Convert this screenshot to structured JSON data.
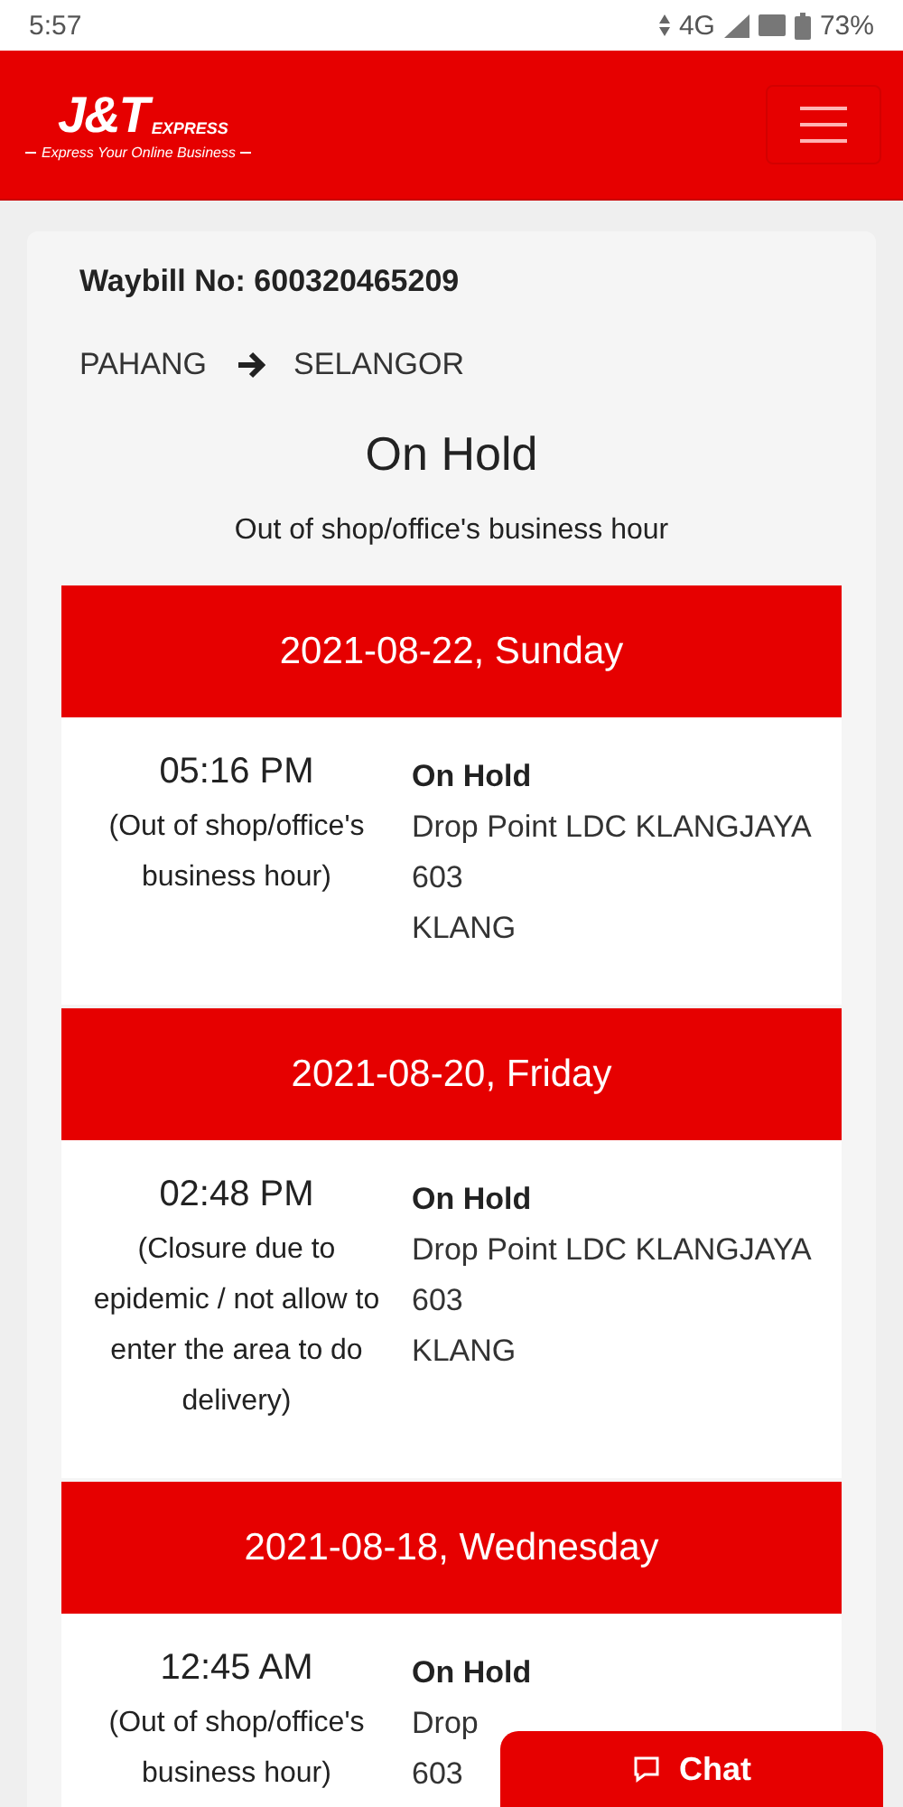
{
  "status_bar": {
    "time": "5:57",
    "network": "4G",
    "battery": "73%"
  },
  "header": {
    "logo_mark": "J&T",
    "logo_word": "EXPRESS",
    "tagline": "Express Your Online Business"
  },
  "waybill": {
    "label": "Waybill No:",
    "number": "600320465209"
  },
  "route": {
    "from": "PAHANG",
    "to": "SELANGOR"
  },
  "current_status": "On Hold",
  "current_note": "Out of shop/office's business hour",
  "days": [
    {
      "date": "2021-08-22, Sunday",
      "events": [
        {
          "time": "05:16 PM",
          "note": "(Out of shop/office's business hour)",
          "status": "On Hold",
          "location_lines": [
            "Drop Point LDC KLANGJAYA 603",
            "KLANG"
          ]
        }
      ]
    },
    {
      "date": "2021-08-20, Friday",
      "events": [
        {
          "time": "02:48 PM",
          "note": "(Closure due to epidemic / not allow to enter the area to do delivery)",
          "status": "On Hold",
          "location_lines": [
            "Drop Point LDC KLANGJAYA 603",
            "KLANG"
          ]
        }
      ]
    },
    {
      "date": "2021-08-18, Wednesday",
      "events": [
        {
          "time": "12:45 AM",
          "note": "(Out of shop/office's business hour)",
          "status": "On Hold",
          "location_lines": [
            "Drop",
            "603"
          ]
        }
      ]
    }
  ],
  "chat_button": {
    "label": "Chat"
  }
}
